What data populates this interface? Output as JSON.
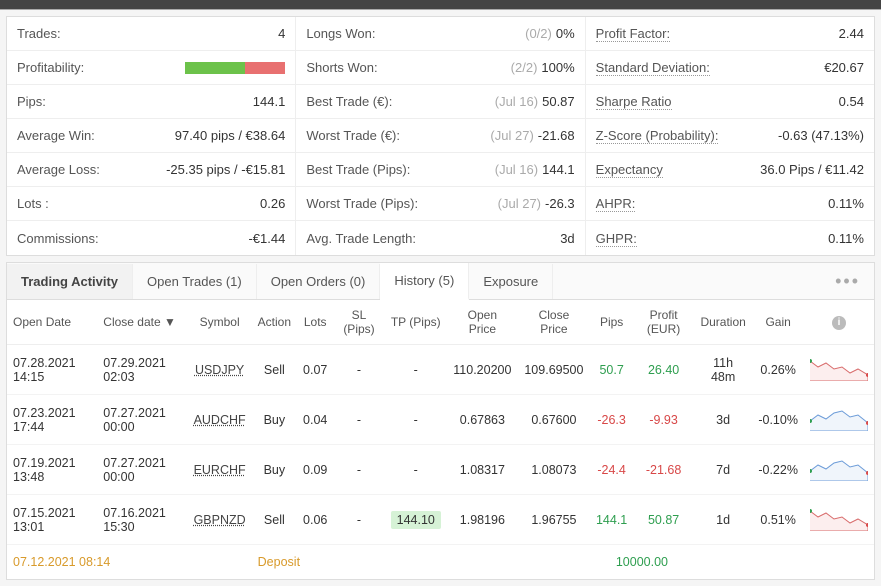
{
  "stats": {
    "col1": [
      {
        "label": "Trades:",
        "value": "4"
      },
      {
        "label": "Profitability:",
        "bar": {
          "green": 60,
          "red": 40
        }
      },
      {
        "label": "Pips:",
        "value": "144.1"
      },
      {
        "label": "Average Win:",
        "value": "97.40 pips / €38.64"
      },
      {
        "label": "Average Loss:",
        "value": "-25.35 pips / -€15.81"
      },
      {
        "label": "Lots :",
        "value": "0.26"
      },
      {
        "label": "Commissions:",
        "value": "-€1.44"
      }
    ],
    "col2": [
      {
        "label": "Longs Won:",
        "sub": "(0/2)",
        "value": "0%"
      },
      {
        "label": "Shorts Won:",
        "sub": "(2/2)",
        "value": "100%"
      },
      {
        "label": "Best Trade (€):",
        "sub": "(Jul 16)",
        "value": "50.87"
      },
      {
        "label": "Worst Trade (€):",
        "sub": "(Jul 27)",
        "value": "-21.68"
      },
      {
        "label": "Best Trade (Pips):",
        "sub": "(Jul 16)",
        "value": "144.1"
      },
      {
        "label": "Worst Trade (Pips):",
        "sub": "(Jul 27)",
        "value": "-26.3"
      },
      {
        "label": "Avg. Trade Length:",
        "value": "3d"
      }
    ],
    "col3": [
      {
        "label": "Profit Factor:",
        "dotted": true,
        "value": "2.44"
      },
      {
        "label": "Standard Deviation:",
        "dotted": true,
        "value": "€20.67"
      },
      {
        "label": "Sharpe Ratio",
        "dotted": true,
        "value": "0.54"
      },
      {
        "label": "Z-Score (Probability):",
        "dotted": true,
        "value": "-0.63 (47.13%)"
      },
      {
        "label": "Expectancy",
        "dotted": true,
        "value": "36.0 Pips / €11.42"
      },
      {
        "label": "AHPR:",
        "dotted": true,
        "value": "0.11%"
      },
      {
        "label": "GHPR:",
        "dotted": true,
        "value": "0.11%"
      }
    ]
  },
  "activity": {
    "title": "Trading Activity",
    "tabs": [
      {
        "label": "Open Trades (1)",
        "active": false
      },
      {
        "label": "Open Orders (0)",
        "active": false
      },
      {
        "label": "History (5)",
        "active": true
      },
      {
        "label": "Exposure",
        "active": false
      }
    ],
    "columns": [
      "Open Date",
      "Close date ▼",
      "Symbol",
      "Action",
      "Lots",
      "SL (Pips)",
      "TP (Pips)",
      "Open Price",
      "Close Price",
      "Pips",
      "Profit (EUR)",
      "Duration",
      "Gain"
    ],
    "rows": [
      {
        "open": "07.28.2021 14:15",
        "close": "07.29.2021 02:03",
        "symbol": "USDJPY",
        "action": "Sell",
        "lots": "0.07",
        "sl": "-",
        "tp": "-",
        "openp": "110.20200",
        "closep": "109.69500",
        "pips": "50.7",
        "pips_pos": true,
        "profit": "26.40",
        "profit_pos": true,
        "duration": "11h 48m",
        "gain": "0.26%",
        "spark": "red"
      },
      {
        "open": "07.23.2021 17:44",
        "close": "07.27.2021 00:00",
        "symbol": "AUDCHF",
        "action": "Buy",
        "lots": "0.04",
        "sl": "-",
        "tp": "-",
        "openp": "0.67863",
        "closep": "0.67600",
        "pips": "-26.3",
        "pips_pos": false,
        "profit": "-9.93",
        "profit_pos": false,
        "duration": "3d",
        "gain": "-0.10%",
        "spark": "blue"
      },
      {
        "open": "07.19.2021 13:48",
        "close": "07.27.2021 00:00",
        "symbol": "EURCHF",
        "action": "Buy",
        "lots": "0.09",
        "sl": "-",
        "tp": "-",
        "openp": "1.08317",
        "closep": "1.08073",
        "pips": "-24.4",
        "pips_pos": false,
        "profit": "-21.68",
        "profit_pos": false,
        "duration": "7d",
        "gain": "-0.22%",
        "spark": "blue"
      },
      {
        "open": "07.15.2021 13:01",
        "close": "07.16.2021 15:30",
        "symbol": "GBPNZD",
        "action": "Sell",
        "lots": "0.06",
        "sl": "-",
        "tp": "144.10",
        "tp_hl": true,
        "openp": "1.98196",
        "closep": "1.96755",
        "pips": "144.1",
        "pips_pos": true,
        "profit": "50.87",
        "profit_pos": true,
        "duration": "1d",
        "gain": "0.51%",
        "spark": "red"
      }
    ],
    "deposit": {
      "date": "07.12.2021 08:14",
      "label": "Deposit",
      "amount": "10000.00"
    }
  },
  "chart_data": {
    "type": "table",
    "title": "Trade History",
    "series": [
      {
        "name": "USDJPY Sell",
        "open_date": "07.28.2021 14:15",
        "close_date": "07.29.2021 02:03",
        "lots": 0.07,
        "open_price": 110.202,
        "close_price": 109.695,
        "pips": 50.7,
        "profit_eur": 26.4,
        "duration_hours": 11.8,
        "gain_pct": 0.26
      },
      {
        "name": "AUDCHF Buy",
        "open_date": "07.23.2021 17:44",
        "close_date": "07.27.2021 00:00",
        "lots": 0.04,
        "open_price": 0.67863,
        "close_price": 0.676,
        "pips": -26.3,
        "profit_eur": -9.93,
        "duration_hours": 72,
        "gain_pct": -0.1
      },
      {
        "name": "EURCHF Buy",
        "open_date": "07.19.2021 13:48",
        "close_date": "07.27.2021 00:00",
        "lots": 0.09,
        "open_price": 1.08317,
        "close_price": 1.08073,
        "pips": -24.4,
        "profit_eur": -21.68,
        "duration_hours": 168,
        "gain_pct": -0.22
      },
      {
        "name": "GBPNZD Sell",
        "open_date": "07.15.2021 13:01",
        "close_date": "07.16.2021 15:30",
        "lots": 0.06,
        "open_price": 1.98196,
        "close_price": 1.96755,
        "pips": 144.1,
        "profit_eur": 50.87,
        "duration_hours": 24,
        "gain_pct": 0.51
      }
    ],
    "summary": {
      "trades": 4,
      "pips": 144.1,
      "avg_win_pips": 97.4,
      "avg_win_eur": 38.64,
      "avg_loss_pips": -25.35,
      "avg_loss_eur": -15.81,
      "lots": 0.26,
      "commissions_eur": -1.44,
      "longs_won": [
        0,
        2
      ],
      "shorts_won": [
        2,
        2
      ],
      "best_trade_eur": 50.87,
      "worst_trade_eur": -21.68,
      "best_trade_pips": 144.1,
      "worst_trade_pips": -26.3,
      "avg_trade_length_days": 3,
      "profit_factor": 2.44,
      "std_dev_eur": 20.67,
      "sharpe": 0.54,
      "z_score": -0.63,
      "z_prob_pct": 47.13,
      "expectancy_pips": 36.0,
      "expectancy_eur": 11.42,
      "ahpr_pct": 0.11,
      "ghpr_pct": 0.11
    }
  }
}
